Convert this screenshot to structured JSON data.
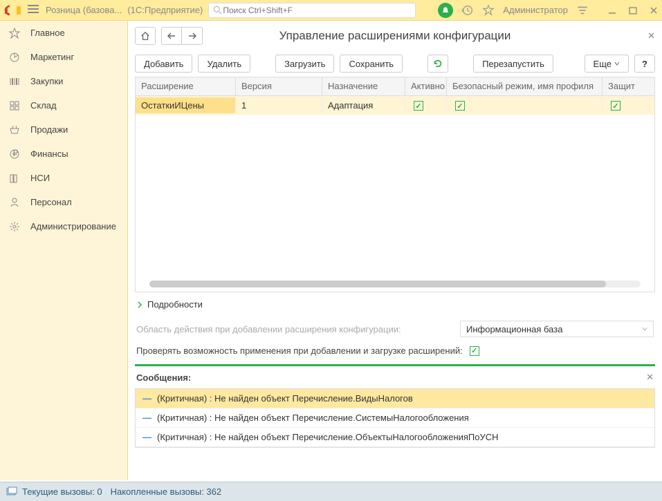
{
  "titlebar": {
    "app_title": "Розница (базова...",
    "app_sub": "(1С:Предприятие)",
    "search_placeholder": "Поиск Ctrl+Shift+F",
    "user": "Администратор"
  },
  "sidebar": {
    "items": [
      {
        "label": "Главное",
        "icon": "star"
      },
      {
        "label": "Маркетинг",
        "icon": "pie"
      },
      {
        "label": "Закупки",
        "icon": "barcode"
      },
      {
        "label": "Склад",
        "icon": "grid"
      },
      {
        "label": "Продажи",
        "icon": "basket"
      },
      {
        "label": "Финансы",
        "icon": "coin"
      },
      {
        "label": "НСИ",
        "icon": "books"
      },
      {
        "label": "Персонал",
        "icon": "person"
      },
      {
        "label": "Администрирование",
        "icon": "gear"
      }
    ]
  },
  "page": {
    "title": "Управление расширениями конфигурации",
    "toolbar": {
      "add": "Добавить",
      "delete": "Удалить",
      "load": "Загрузить",
      "save": "Сохранить",
      "restart": "Перезапустить",
      "more": "Еще"
    },
    "columns": {
      "c1": "Расширение",
      "c2": "Версия",
      "c3": "Назначение",
      "c4": "Активно",
      "c5": "Безопасный режим, имя профиля",
      "c6": "Защит"
    },
    "row": {
      "name": "ОстаткиИЦены",
      "version": "1",
      "purpose": "Адаптация"
    },
    "details_label": "Подробности",
    "scope_label": "Область действия при добавлении расширения конфигурации:",
    "scope_value": "Информационная база",
    "check_label": "Проверять возможность применения при добавлении и загрузке расширений:",
    "messages_title": "Сообщения:",
    "messages": [
      "(Критичная) : Не найден объект Перечисление.ВидыНалогов",
      "(Критичная) : Не найден объект Перечисление.СистемыНалогообложения",
      "(Критичная) : Не найден объект Перечисление.ОбъектыНалогообложенияПоУСН"
    ]
  },
  "status": {
    "current": "Текущие вызовы:  0",
    "accum": "Накопленные вызовы:  362"
  }
}
